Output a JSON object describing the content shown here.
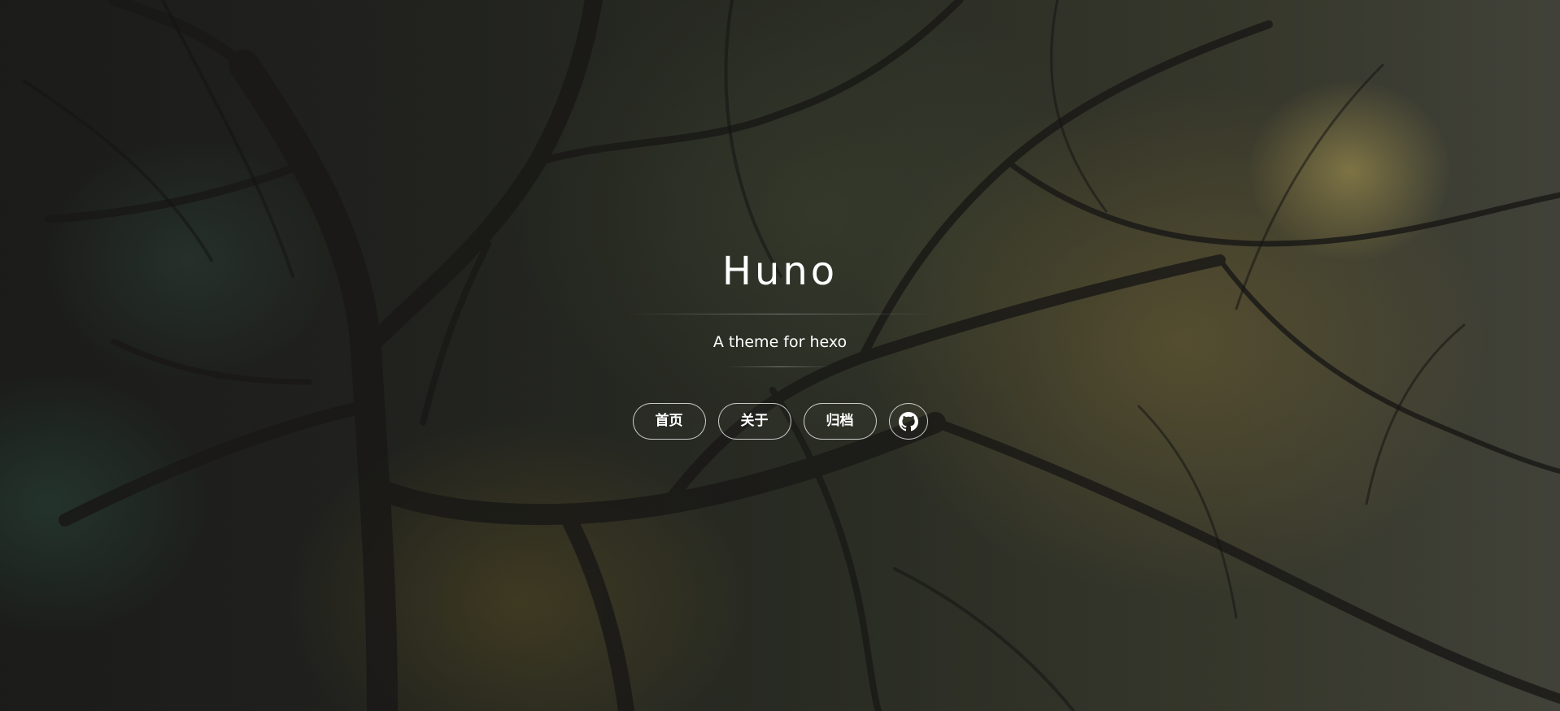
{
  "site": {
    "title": "Huno",
    "subtitle": "A theme for hexo"
  },
  "nav": {
    "items": [
      {
        "label": "首页"
      },
      {
        "label": "关于"
      },
      {
        "label": "归档"
      }
    ],
    "github_icon": "github-icon"
  },
  "colors": {
    "text": "#ffffff",
    "button_border": "#d9d9d9"
  }
}
